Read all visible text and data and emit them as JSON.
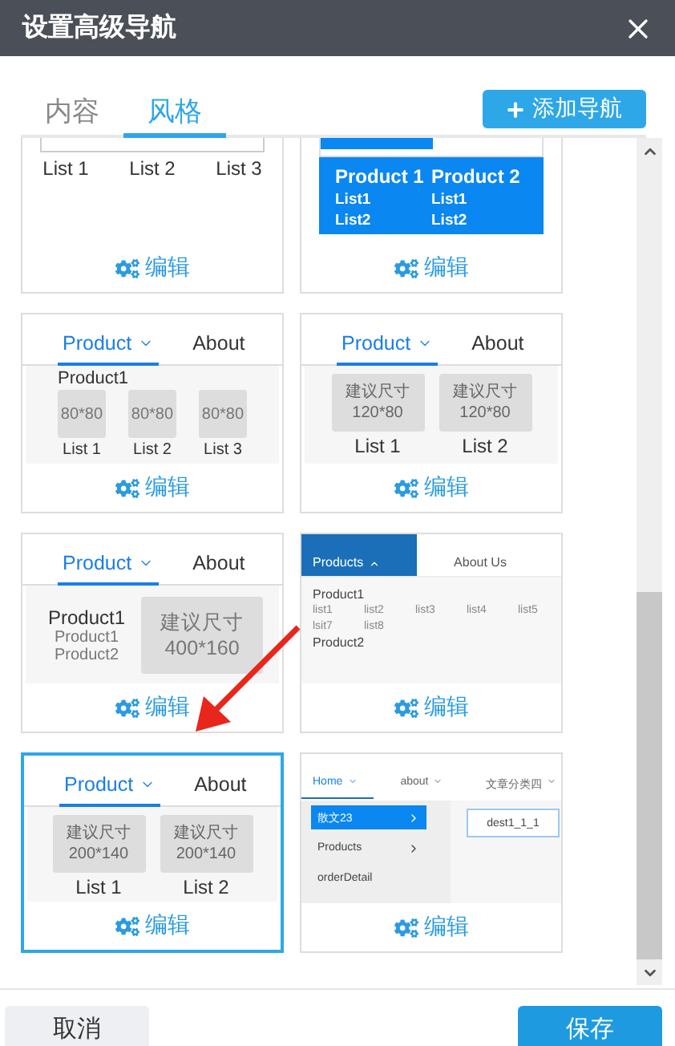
{
  "dialog": {
    "title": "设置高级导航"
  },
  "tabs": [
    {
      "label": "内容",
      "selected": false
    },
    {
      "label": "风格",
      "selected": true
    }
  ],
  "add_button": {
    "label": "添加导航"
  },
  "cards": [
    {
      "kind": "list-row",
      "selected": false,
      "edit_label": "编辑",
      "lists": [
        "List 1",
        "List 2",
        "List 3"
      ]
    },
    {
      "kind": "mega-blue",
      "selected": false,
      "edit_label": "编辑",
      "columns": [
        {
          "title": "Product 1",
          "items": [
            "List1",
            "List2"
          ]
        },
        {
          "title": "Product 2",
          "items": [
            "List1",
            "List2"
          ]
        }
      ]
    },
    {
      "kind": "tabs-thumbs",
      "selected": false,
      "edit_label": "编辑",
      "nav": [
        {
          "label": "Product",
          "selected": true,
          "dropdown": true
        },
        {
          "label": "About",
          "selected": false,
          "dropdown": false
        }
      ],
      "heading": "Product1",
      "thumbs": [
        {
          "size": "80*80",
          "label": "List 1"
        },
        {
          "size": "80*80",
          "label": "List 2"
        },
        {
          "size": "80*80",
          "label": "List 3"
        }
      ]
    },
    {
      "kind": "tabs-suggest",
      "selected": false,
      "edit_label": "编辑",
      "nav": [
        {
          "label": "Product",
          "selected": true,
          "dropdown": true
        },
        {
          "label": "About",
          "selected": false,
          "dropdown": false
        }
      ],
      "thumbs": [
        {
          "hint": "建议尺寸",
          "size": "120*80",
          "label": "List 1"
        },
        {
          "hint": "建议尺寸",
          "size": "120*80",
          "label": "List 2"
        }
      ]
    },
    {
      "kind": "tabs-side",
      "selected": false,
      "edit_label": "编辑",
      "nav": [
        {
          "label": "Product",
          "selected": true,
          "dropdown": true
        },
        {
          "label": "About",
          "selected": false,
          "dropdown": false
        }
      ],
      "heading": "Product1",
      "subs": [
        "Product1",
        "Product2"
      ],
      "banner": {
        "hint": "建议尺寸",
        "size": "400*160"
      }
    },
    {
      "kind": "dark-mega",
      "selected": false,
      "edit_label": "编辑",
      "nav": [
        {
          "label": "Products",
          "selected": true,
          "dropdown": true
        },
        {
          "label": "About Us",
          "selected": false,
          "dropdown": false
        }
      ],
      "groups": [
        {
          "title": "Product1",
          "items": [
            "list1",
            "list2",
            "list3",
            "list4",
            "list5",
            "lsit7",
            "list8"
          ]
        },
        {
          "title": "Product2"
        }
      ]
    },
    {
      "kind": "tabs-suggest",
      "selected": true,
      "edit_label": "编辑",
      "nav": [
        {
          "label": "Product",
          "selected": true,
          "dropdown": true
        },
        {
          "label": "About",
          "selected": false,
          "dropdown": false
        }
      ],
      "thumbs": [
        {
          "hint": "建议尺寸",
          "size": "200*140",
          "label": "List 1"
        },
        {
          "hint": "建议尺寸",
          "size": "200*140",
          "label": "List 2"
        }
      ]
    },
    {
      "kind": "side-menu",
      "selected": false,
      "edit_label": "编辑",
      "nav": [
        {
          "label": "Home",
          "selected": true,
          "dropdown": true
        },
        {
          "label": "about",
          "selected": false,
          "dropdown": true
        },
        {
          "label": "文章分类四",
          "selected": false,
          "dropdown": true
        }
      ],
      "menu": [
        {
          "label": "散文23",
          "selected": true,
          "arrow": true
        },
        {
          "label": "Products",
          "selected": false,
          "arrow": true
        },
        {
          "label": "orderDetail",
          "selected": false,
          "arrow": false
        }
      ],
      "field": "dest1_1_1"
    }
  ],
  "footer": {
    "cancel": "取消",
    "save": "保存"
  }
}
